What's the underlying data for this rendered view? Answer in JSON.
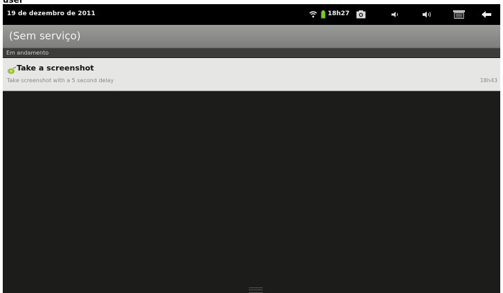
{
  "cropped_caption": "user",
  "status_bar": {
    "date": "19 de dezembro de 2011",
    "time": "18h27",
    "icons": [
      "wifi-icon",
      "battery-icon",
      "screenshot-icon",
      "volume-down-icon",
      "volume-up-icon",
      "menu-icon",
      "back-icon"
    ]
  },
  "header": {
    "title": "(Sem serviço)"
  },
  "section": {
    "label": "Em andamento"
  },
  "notification": {
    "title": "Take a screenshot",
    "subtitle": "Take screenshot with a 5 second delay",
    "time": "18h43"
  },
  "colors": {
    "statusbar": "#000000",
    "header": "#8a8a88",
    "panel": "#1c1c1a",
    "notification": "#e6e6e4"
  }
}
